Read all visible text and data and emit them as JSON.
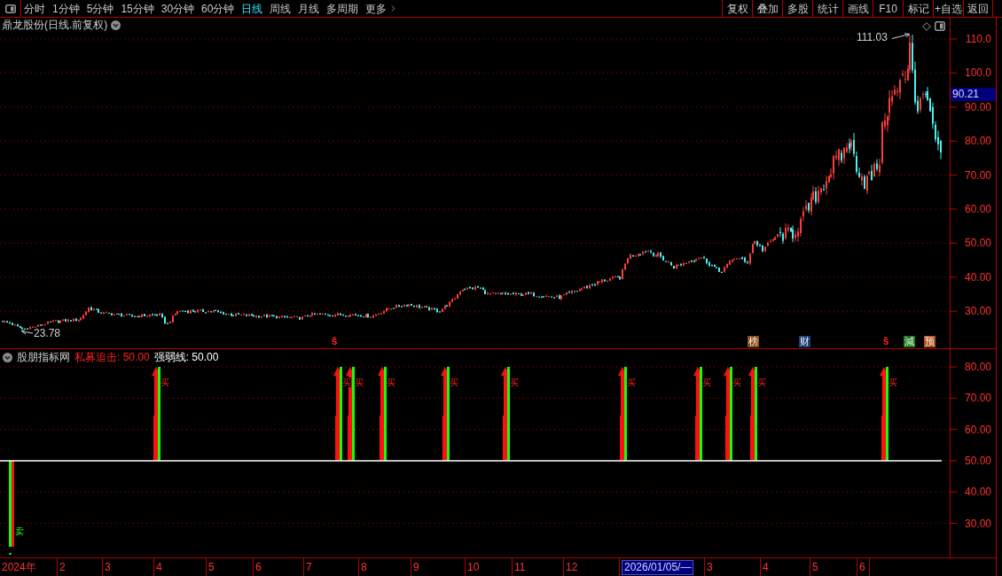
{
  "toolbar": {
    "periods": [
      {
        "label": "分时",
        "selected": false
      },
      {
        "label": "1分钟",
        "selected": false
      },
      {
        "label": "5分钟",
        "selected": false
      },
      {
        "label": "15分钟",
        "selected": false
      },
      {
        "label": "30分钟",
        "selected": false
      },
      {
        "label": "60分钟",
        "selected": false
      },
      {
        "label": "日线",
        "selected": true
      },
      {
        "label": "周线",
        "selected": false
      },
      {
        "label": "月线",
        "selected": false
      },
      {
        "label": "多周期",
        "selected": false
      }
    ],
    "more": "更多",
    "buttons": [
      "复权",
      "叠加",
      "多股",
      "统计",
      "画线",
      "F10",
      "标记",
      "+自选",
      "返回"
    ]
  },
  "price_chart": {
    "title": "鼎龙股份(日线.前复权)",
    "high_label": "111.03",
    "low_label": "23.78",
    "current_price": "90.21",
    "axis_ticks": [
      "110.0",
      "100.0",
      "90.00",
      "80.00",
      "70.00",
      "60.00",
      "50.00",
      "40.00",
      "30.00"
    ],
    "event_markers": [
      {
        "kind": "text",
        "label": "ŝ",
        "color": "#ff2020"
      },
      {
        "kind": "tile",
        "label": "榜",
        "color": "#8a4a12"
      },
      {
        "kind": "tile",
        "label": "财",
        "color": "#1c3f78"
      },
      {
        "kind": "text",
        "label": "ŝ",
        "color": "#ff2020"
      },
      {
        "kind": "tile",
        "label": "減",
        "color": "#1f7a1f"
      },
      {
        "kind": "tile",
        "label": "预",
        "color": "#b4501a"
      }
    ]
  },
  "indicator": {
    "source": "股朋指标网",
    "series": [
      {
        "label": "私募追击: 50.00",
        "color": "#ff2020"
      },
      {
        "label": "强弱线: 50.00",
        "color": "#ffffff"
      }
    ],
    "axis_ticks": [
      "80.00",
      "70.00",
      "60.00",
      "50.00",
      "40.00",
      "30.00"
    ],
    "signals": [
      {
        "kind": "sell",
        "label": "卖"
      },
      {
        "kind": "buy",
        "label": "买"
      },
      {
        "kind": "buy",
        "label": "买"
      },
      {
        "kind": "buy",
        "label": "买"
      },
      {
        "kind": "buy",
        "label": "买"
      },
      {
        "kind": "buy",
        "label": "买"
      },
      {
        "kind": "buy",
        "label": "买"
      },
      {
        "kind": "buy",
        "label": "买"
      },
      {
        "kind": "buy",
        "label": "买"
      },
      {
        "kind": "buy",
        "label": "买"
      },
      {
        "kind": "buy",
        "label": "买"
      },
      {
        "kind": "buy",
        "label": "买"
      }
    ]
  },
  "date_axis": [
    {
      "label": "2024年",
      "selected": false
    },
    {
      "label": "2",
      "selected": false
    },
    {
      "label": "3",
      "selected": false
    },
    {
      "label": "4",
      "selected": false
    },
    {
      "label": "5",
      "selected": false
    },
    {
      "label": "6",
      "selected": false
    },
    {
      "label": "7",
      "selected": false
    },
    {
      "label": "8",
      "selected": false
    },
    {
      "label": "9",
      "selected": false
    },
    {
      "label": "10",
      "selected": false
    },
    {
      "label": "11",
      "selected": false
    },
    {
      "label": "12",
      "selected": false
    },
    {
      "label": "2026/01/05/—",
      "selected": true
    },
    {
      "label": "3",
      "selected": false
    },
    {
      "label": "4",
      "selected": false
    },
    {
      "label": "5",
      "selected": false
    },
    {
      "label": "6",
      "selected": false
    }
  ]
}
